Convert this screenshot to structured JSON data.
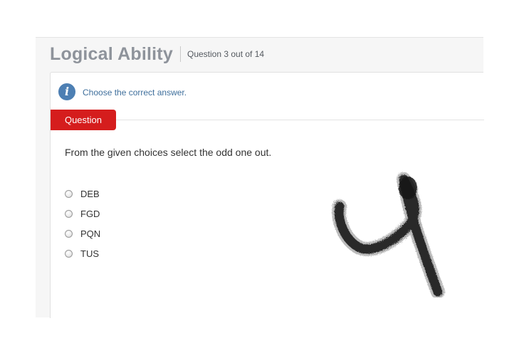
{
  "header": {
    "title": "Logical Ability",
    "counter": "Question 3 out of 14"
  },
  "instruction": {
    "icon": "info-icon",
    "text": "Choose the correct answer."
  },
  "question": {
    "tab_label": "Question",
    "text": "From the given choices select the odd one out.",
    "options": [
      {
        "label": "DEB",
        "selected": false
      },
      {
        "label": "FGD",
        "selected": false
      },
      {
        "label": "PQN",
        "selected": false
      },
      {
        "label": "TUS",
        "selected": false
      }
    ]
  },
  "colors": {
    "title": "#8e939b",
    "accent_tab": "#d51d1d",
    "info_icon": "#4d7fb3",
    "instruction_text": "#3f6f9c"
  },
  "overlay": {
    "icon": "handwritten-4-scribble"
  }
}
